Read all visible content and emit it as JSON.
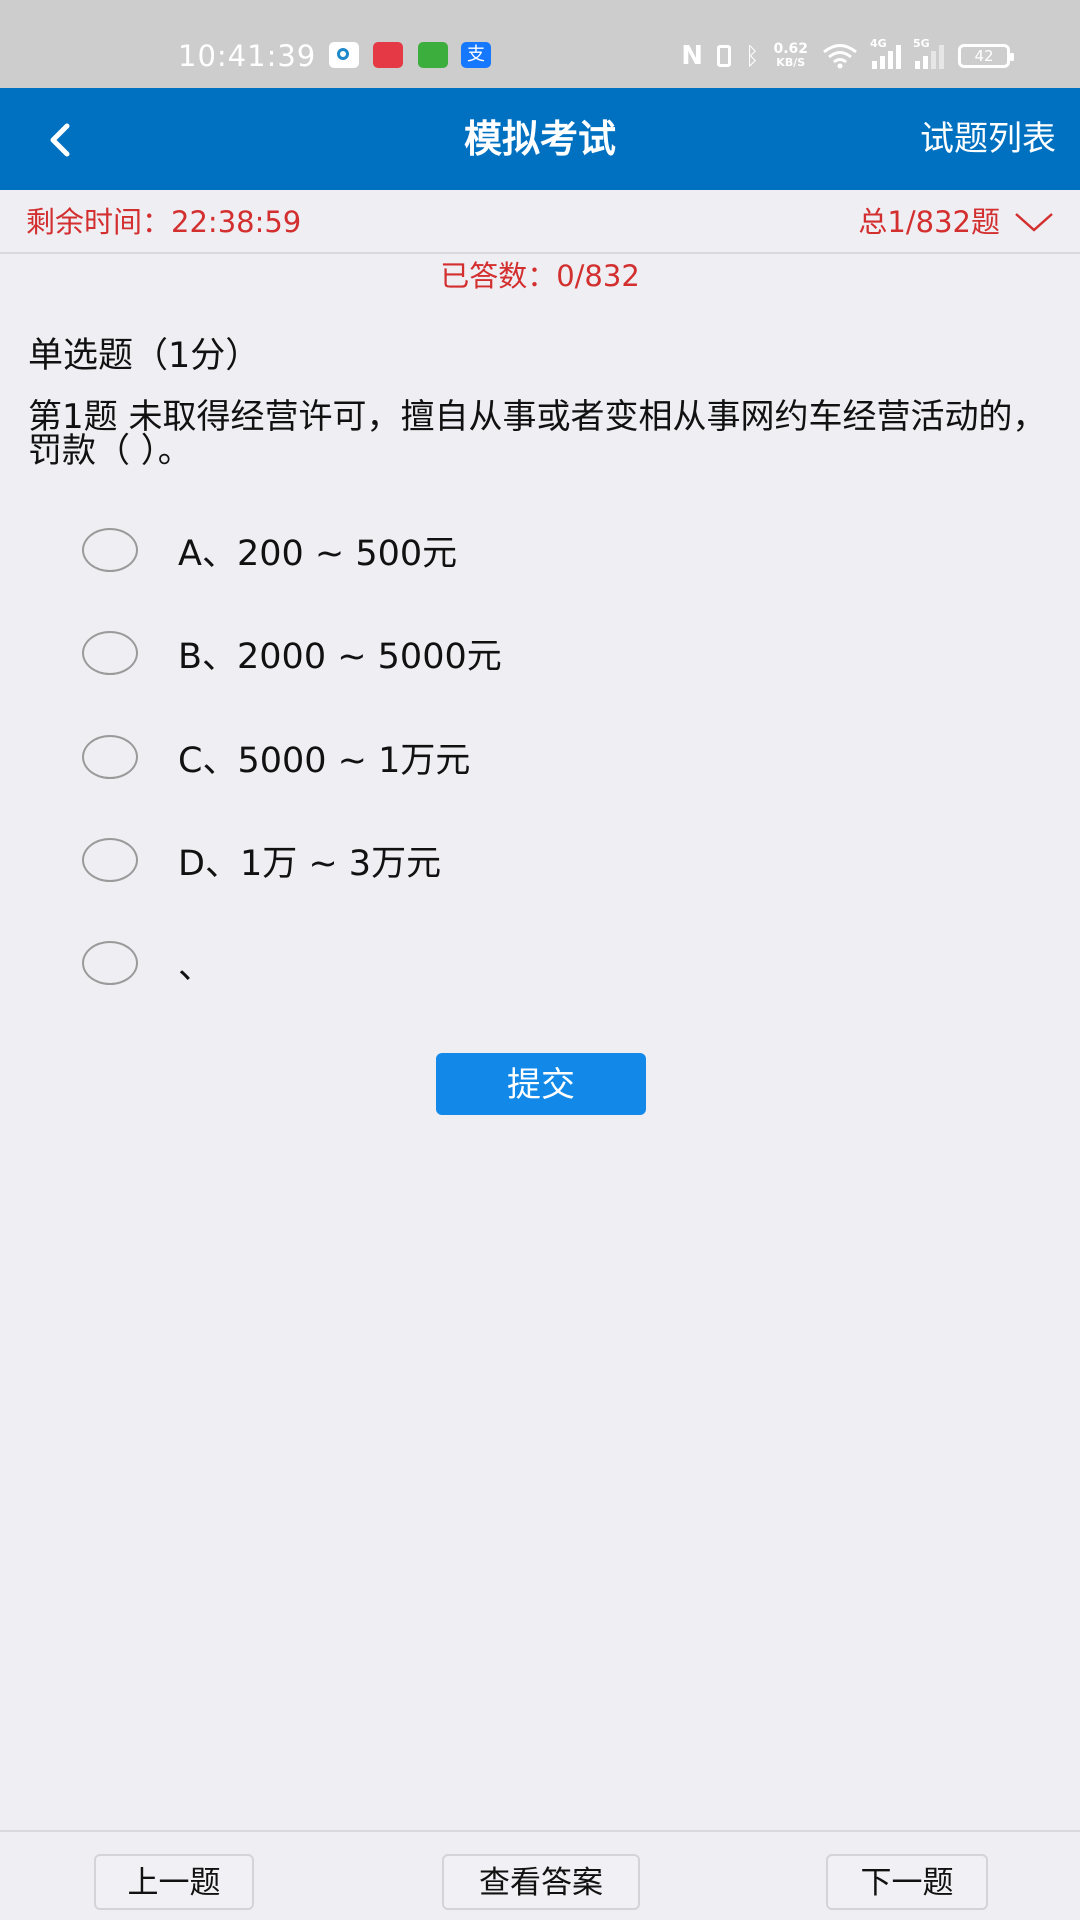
{
  "status_bar": {
    "time": "10:41:39",
    "net_speed_value": "0.62",
    "net_speed_unit": "KB/S",
    "signal_1_label": "4G",
    "signal_2_label": "5G",
    "battery": "42",
    "icons": [
      "nfc-icon",
      "vibrate-icon",
      "bluetooth-icon",
      "wifi-icon",
      "signal-icon",
      "battery-icon"
    ]
  },
  "header": {
    "title": "模拟考试",
    "right_link": "试题列表"
  },
  "exam": {
    "remaining_label": "剩余时间：",
    "remaining_time": "22:38:59",
    "progress_text": "总1/832题",
    "answered_text": "已答数：0/832"
  },
  "question": {
    "type_label": "单选题（1分）",
    "text": "第1题 未取得经营许可，擅自从事或者变相从事网约车经营活动的，罚款（ ）。",
    "options": [
      {
        "label": "A、200 ~ 500元"
      },
      {
        "label": "B、2000 ~ 5000元"
      },
      {
        "label": "C、5000 ~ 1万元"
      },
      {
        "label": "D、1万 ~ 3万元"
      },
      {
        "label": "、"
      }
    ],
    "submit_label": "提交"
  },
  "footer": {
    "prev_label": "上一题",
    "answer_label": "查看答案",
    "next_label": "下一题"
  },
  "colors": {
    "app_bar": "#0071c1",
    "accent_red": "#d32f2f",
    "submit_blue": "#1289e8",
    "background": "#eeeef3"
  }
}
